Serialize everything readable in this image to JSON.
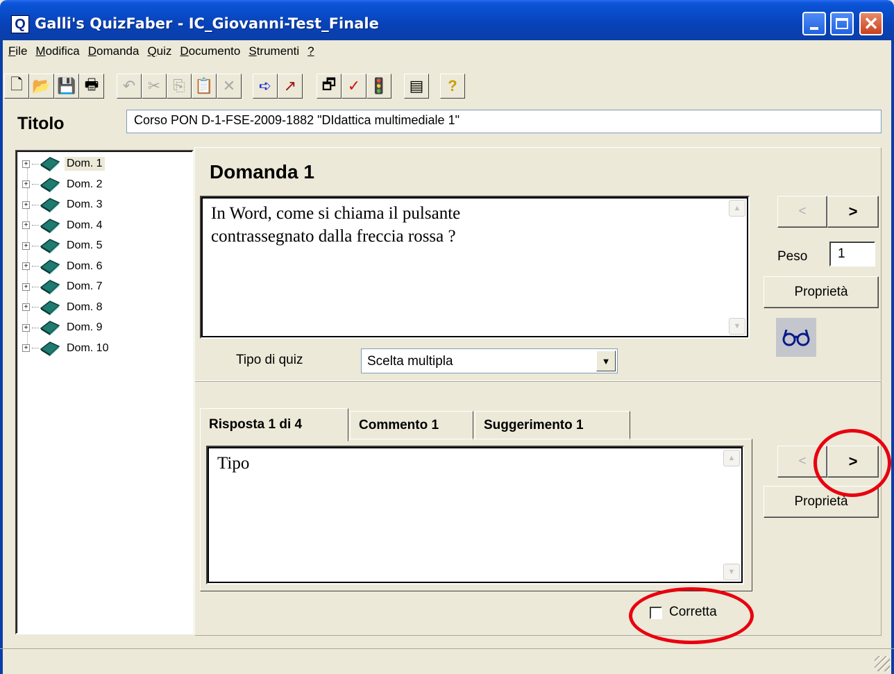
{
  "window": {
    "app_icon": "Q",
    "title": "Galli's QuizFaber - IC_Giovanni-Test_Finale",
    "min_icon": "minimize-icon",
    "max_icon": "maximize-icon",
    "close_glyph": "✕"
  },
  "menu": [
    {
      "key": "F",
      "rest": "ile"
    },
    {
      "key": "M",
      "rest": "odifica"
    },
    {
      "key": "D",
      "rest": "omanda"
    },
    {
      "key": "Q",
      "rest": "uiz"
    },
    {
      "key": "D",
      "rest": "ocumento"
    },
    {
      "key": "S",
      "rest": "trumenti"
    },
    {
      "key": "?",
      "rest": ""
    }
  ],
  "toolbar": {
    "new": "🗋",
    "open": "📂",
    "save": "💾",
    "print": "🖶",
    "undo": "↶",
    "cut": "✂",
    "copy": "⎘",
    "paste": "📋",
    "delete": "✕",
    "goto": "➪",
    "nav": "↗",
    "props": "🗗",
    "check": "✓",
    "traffic": "🚦",
    "list": "▤",
    "help": "?"
  },
  "titolo": {
    "label": "Titolo",
    "value": "Corso PON D-1-FSE-2009-1882 \"DIdattica multimediale 1\""
  },
  "tree": {
    "items": [
      "Dom. 1",
      "Dom. 2",
      "Dom. 3",
      "Dom. 4",
      "Dom. 5",
      "Dom. 6",
      "Dom. 7",
      "Dom. 8",
      "Dom. 9",
      "Dom. 10"
    ],
    "selected": "Dom. 1"
  },
  "question": {
    "title": "Domanda 1",
    "text_line1": "In Word, come si chiama il pulsante",
    "text_line2": "contrassegnato dalla freccia rossa ?",
    "prev_label": "<",
    "next_label": ">",
    "peso_label": "Peso",
    "peso_value": "1",
    "proprieta_label": "Proprietà",
    "tipo_label": "Tipo di quiz",
    "tipo_value": "Scelta multipla",
    "tipo_arrow": "▼"
  },
  "answer": {
    "tabs": [
      "Risposta 1 di 4",
      "Commento 1",
      "Suggerimento 1"
    ],
    "text": "Tipo",
    "prev_label": "<",
    "next_label": ">",
    "proprieta_label": "Proprietà",
    "corretta_label": "Corretta",
    "corretta_checked": false
  },
  "scroll": {
    "up": "▲",
    "down": "▼"
  },
  "colors": {
    "titlebar": "#0a55d8",
    "face": "#ece9d8",
    "annotation": "#e8000f"
  }
}
